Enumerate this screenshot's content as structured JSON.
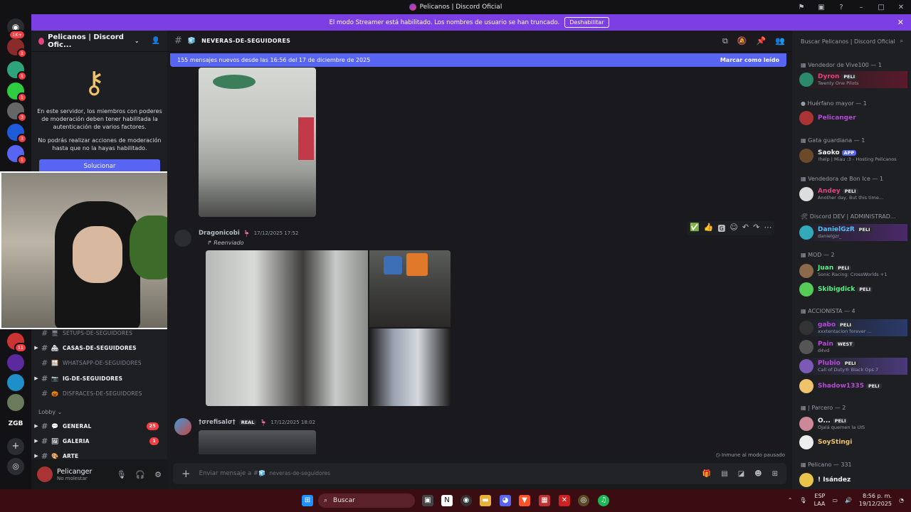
{
  "window": {
    "title": "Pelicanos | Discord Oficial"
  },
  "banner": {
    "text": "El modo Streamer está habilitado. Los nombres de usuario se han truncado.",
    "button": "Deshabilitar"
  },
  "guilds": {
    "top_badge": "1K+",
    "badges": [
      "1",
      "1",
      "1",
      "3",
      "3",
      "1"
    ],
    "lower_badge": "11",
    "zgb": "ZGB"
  },
  "server": {
    "name": "Pelicanos | Discord Ofic...",
    "mfa_text_1": "En este servidor, los miembros con poderes de moderación deben tener habilitada la autenticación de varios factores.",
    "mfa_text_2": "No podrás realizar acciones de moderación hasta que no la hayas habilitado.",
    "fix_button": "Solucionar"
  },
  "channels": [
    {
      "name": "setups-de-seguidores",
      "emoji": "🖥",
      "bold": false
    },
    {
      "name": "casas-de-seguidores",
      "emoji": "🏘",
      "bold": true
    },
    {
      "name": "whatsapp-de-seguidores",
      "emoji": "🪟",
      "bold": false
    },
    {
      "name": "ig-de-seguidores",
      "emoji": "📷",
      "bold": true
    },
    {
      "name": "disfraces-de-seguidores",
      "emoji": "🎃",
      "bold": false
    }
  ],
  "lobby": {
    "label": "Lobby",
    "channels": [
      {
        "name": "general",
        "emoji": "💬",
        "badge": "25"
      },
      {
        "name": "galeria",
        "emoji": "🖼",
        "badge": "1"
      },
      {
        "name": "arte",
        "emoji": "🎨",
        "badge": ""
      }
    ]
  },
  "user": {
    "name": "Pelicanger",
    "status": "No molestar"
  },
  "channel_header": {
    "name": "NEVERAS-DE-SEGUIDORES"
  },
  "new_messages": {
    "text": "155 mensajes nuevos desde las 16:56 del 17 de diciembre de 2025",
    "mark": "Marcar como leído"
  },
  "messages": [
    {
      "author": "Dragonicobi",
      "time": "17/12/2025 17:52",
      "forwarded": "Reenviado"
    },
    {
      "author": "†σrefisalσ†",
      "tag": "REAL",
      "time": "17/12/2025 18:02"
    }
  ],
  "immune": "Inmune al modo pausado",
  "composer": {
    "placeholder": "Enviar mensaje a #",
    "channel": "neveras-de-seguidores"
  },
  "member_search": "Buscar Pelicanos | Discord Oficial",
  "roles": [
    {
      "label": "Vendedor de Vive100 — 1"
    },
    {
      "label": "Huérfano mayor — 1"
    },
    {
      "label": "Gata guardiana — 1"
    },
    {
      "label": "Vendedora de Bon Ice — 1"
    },
    {
      "label": "Discord DEV | ADMINISTRAD..."
    },
    {
      "label": "MOD — 2"
    },
    {
      "label": "ACCIONISTA — 4"
    },
    {
      "label": "| Parcero — 2"
    },
    {
      "label": "Pelicano — 331"
    }
  ],
  "members": [
    {
      "name": "Dyron",
      "tag": "PELI",
      "status": "Twenty One Pilots",
      "color": "#e2447c"
    },
    {
      "name": "Pelicanger",
      "tag": "",
      "status": "",
      "color": "#b34bd4"
    },
    {
      "name": "Saoko",
      "tag": "APP",
      "status": "!help | Miau :3 - Hosting Pelicanos",
      "color": "#f2f3f5"
    },
    {
      "name": "Andey",
      "tag": "PELI",
      "status": "Another day, But this time...",
      "color": "#e2447c"
    },
    {
      "name": "DanielGzR",
      "tag": "PELI",
      "status": "danielgzr_",
      "color": "#4fc3f7"
    },
    {
      "name": "Juan",
      "tag": "PELI",
      "status": "Sonic Racing: CrossWorlds +1",
      "color": "#57f287"
    },
    {
      "name": "Skibigdick",
      "tag": "PELI",
      "status": "",
      "color": "#57f287"
    },
    {
      "name": "gabo",
      "tag": "PELI",
      "status": "xxxtentacion forever ...",
      "color": "#b34bd4"
    },
    {
      "name": "Pain",
      "tag": "WEST",
      "status": "d4vd",
      "color": "#b34bd4"
    },
    {
      "name": "Plubio",
      "tag": "PELI",
      "status": "Call of Duty® Black Ops 7",
      "color": "#b34bd4"
    },
    {
      "name": "Shadow1335",
      "tag": "PELI",
      "status": "",
      "color": "#b34bd4"
    },
    {
      "name": "O...",
      "tag": "PELI",
      "status": "Ojalá quemen la UIS",
      "color": "#f2f3f5"
    },
    {
      "name": "SoyStingi",
      "tag": "",
      "status": "",
      "color": "#f0c36a"
    },
    {
      "name": "! Isández",
      "tag": "",
      "status": "",
      "color": "#f2f3f5"
    }
  ],
  "taskbar": {
    "search": "Buscar",
    "lang": "ESP",
    "layout": "LAA",
    "time": "8:56 p. m.",
    "date": "19/12/2025"
  }
}
